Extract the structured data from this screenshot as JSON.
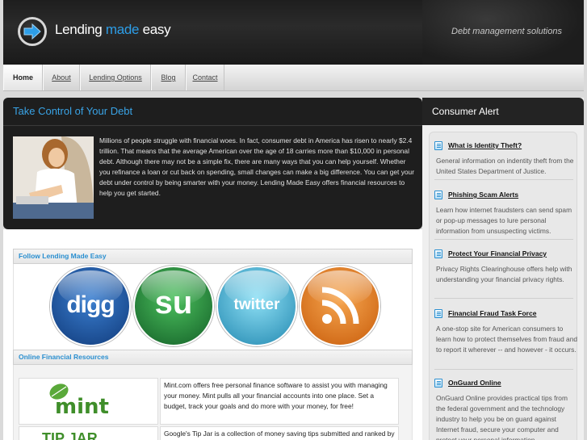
{
  "header": {
    "logo_part1": "Lending ",
    "logo_part2": "made",
    "logo_part3": " easy",
    "tagline": "Debt management solutions"
  },
  "nav": {
    "items": [
      "Home",
      "About",
      "Lending Options",
      "Blog",
      "Contact"
    ],
    "active": "Home"
  },
  "feature": {
    "title": "Take Control of Your Debt",
    "text": "Millions of people struggle with financial woes. In fact, consumer debt in America has risen to nearly $2.4 trillion. That means that the average American over the age of 18 carries more than $10,000 in personal debt. Although there may not be a simple fix, there are many ways that you can help yourself. Whether you refinance a loan or cut back on spending, small changes can make a big difference. You can get your debt under control by being smarter with your money. Lending Made Easy offers financial resources to help you get started."
  },
  "follow": {
    "heading": "Follow Lending Made Easy",
    "networks": [
      {
        "label": "digg",
        "icon": "digg-icon",
        "color": "#1b4f9b"
      },
      {
        "label": "su",
        "icon": "stumbleupon-icon",
        "color": "#1f8a3a"
      },
      {
        "label": "twitter",
        "icon": "twitter-icon",
        "color": "#35a7cc"
      },
      {
        "label": "rss",
        "icon": "rss-icon",
        "color": "#e8781a"
      }
    ]
  },
  "resources": {
    "heading": "Online Financial Resources",
    "items": [
      {
        "logo": "mint",
        "text": "Mint.com offers free personal finance software to assist you with managing your money. Mint pulls all your financial accounts into one place. Set a budget, track your goals and do more with your money, for free!"
      },
      {
        "logo": "TIP JAR",
        "text": "Google's Tip Jar is a collection of money saving tips submitted and ranked by the web community. Tip Jar makes it easier to spend less and save more."
      }
    ]
  },
  "sidebar": {
    "title": "Consumer Alert",
    "alerts": [
      {
        "title": "What is Identity Theft?",
        "desc": "General information on indentity theft from the United States Department of Justice."
      },
      {
        "title": "Phishing Scam Alerts",
        "desc": "Learn how internet fraudsters can send spam or pop-up messages to lure personal information from unsuspecting victims."
      },
      {
        "title": "Protect Your Financial Privacy",
        "desc": "Privacy Rights Clearinghouse offers help with understanding your financial privacy rights."
      },
      {
        "title": "Financial Fraud Task Force",
        "desc": "A one-stop site for American consumers to learn how to protect themselves from fraud and to report it wherever -- and however - it occurs."
      },
      {
        "title": "OnGuard Online",
        "desc": "OnGuard Online provides practical tips from the federal government and the technology industry to help you be on guard against Internet fraud, secure your computer and protect your personal information."
      }
    ]
  }
}
